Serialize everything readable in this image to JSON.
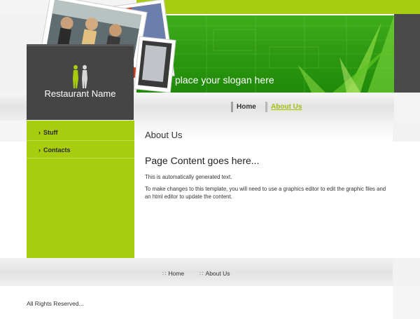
{
  "brand": {
    "name": "Restaurant Name",
    "slogan": "place your slogan here"
  },
  "nav": {
    "items": [
      {
        "label": "Home"
      },
      {
        "label": "About Us"
      }
    ]
  },
  "sidebar": {
    "items": [
      {
        "label": "Stuff"
      },
      {
        "label": "Contacts"
      }
    ]
  },
  "content": {
    "page_title": "About Us",
    "heading": "Page Content goes here...",
    "paragraphs": [
      "This is automatically generated text.",
      "To make changes to this template, you will need to use a graphics editor to edit the graphic files and an html editor to update the content."
    ]
  },
  "footer": {
    "links": [
      {
        "label": "Home"
      },
      {
        "label": "About Us"
      }
    ],
    "copyright": "All Rights Reserved..."
  },
  "colors": {
    "accent": "#a8cc0e",
    "banner": "#2f9a12",
    "logo_box": "#454545"
  },
  "icons": {
    "logo": "two-silhouettes-icon",
    "sidebar_bullet": "chevron-right-icon",
    "footer_bullet": "dotted-bullet-icon"
  }
}
